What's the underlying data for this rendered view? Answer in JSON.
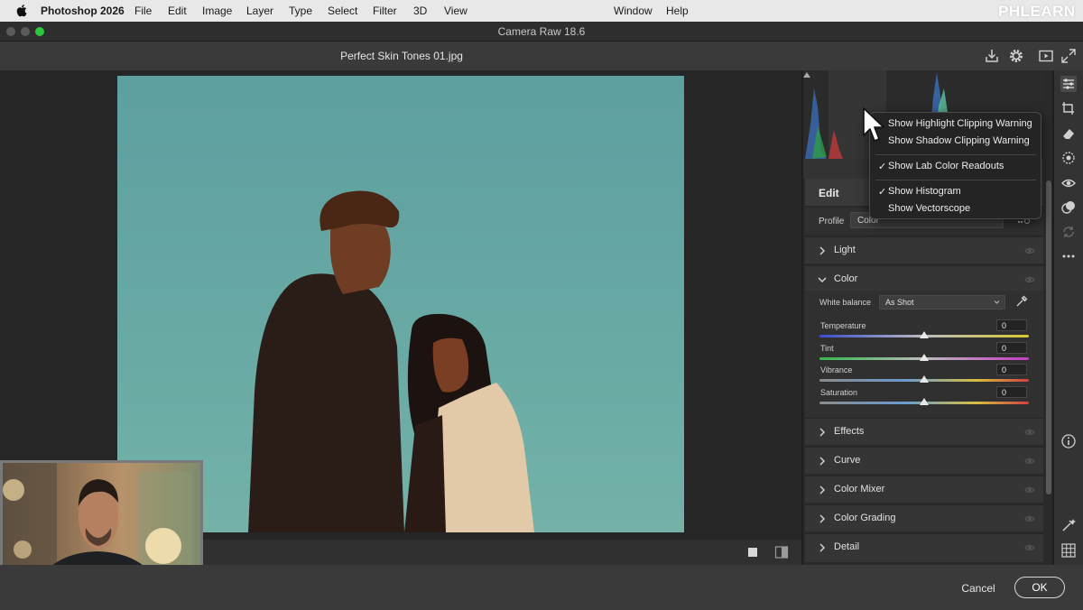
{
  "menubar": {
    "app_name": "Photoshop 2026",
    "items": [
      "File",
      "Edit",
      "Image",
      "Layer",
      "Type",
      "Select",
      "Filter",
      "3D",
      "View",
      "Window",
      "Help"
    ],
    "brand": "PHLEARN"
  },
  "window": {
    "title": "Camera Raw 18.6"
  },
  "file": {
    "name": "Perfect Skin Tones 01.jpg"
  },
  "toolbar_icons": [
    "save-icon",
    "gear-icon",
    "slideshow-icon",
    "fullscreen-icon"
  ],
  "context_menu": {
    "items": [
      {
        "label": "Show Highlight Clipping Warning",
        "checked": false
      },
      {
        "label": "Show Shadow Clipping Warning",
        "checked": false
      },
      {
        "label": "Show Lab Color Readouts",
        "checked": true
      },
      {
        "label": "Show Histogram",
        "checked": true
      },
      {
        "label": "Show Vectorscope",
        "checked": false
      }
    ],
    "check_glyph": "✓"
  },
  "edit": {
    "title": "Edit",
    "profile_label": "Profile",
    "profile_value": "Color"
  },
  "sections": {
    "light": "Light",
    "color": "Color",
    "effects": "Effects",
    "curve": "Curve",
    "color_mixer": "Color Mixer",
    "color_grading": "Color Grading",
    "detail": "Detail"
  },
  "color_panel": {
    "white_balance_label": "White balance",
    "white_balance_value": "As Shot",
    "sliders": [
      {
        "label": "Temperature",
        "value": "0"
      },
      {
        "label": "Tint",
        "value": "0"
      },
      {
        "label": "Vibrance",
        "value": "0"
      },
      {
        "label": "Saturation",
        "value": "0"
      }
    ]
  },
  "tools": [
    "edit-sliders-icon",
    "crop-icon",
    "eraser-icon",
    "masking-icon",
    "red-eye-icon",
    "presets-icon",
    "snapshots-icon",
    "more-icon",
    "info-icon",
    "ai-brush-icon",
    "grid-icon"
  ],
  "footer": {
    "cancel": "Cancel",
    "ok": "OK"
  },
  "colors": {
    "menubar_bg": "#e8e8e8",
    "panel_bg": "#2a2a2a",
    "section_bg": "#353535",
    "photo_sky": "#68a9a4"
  }
}
